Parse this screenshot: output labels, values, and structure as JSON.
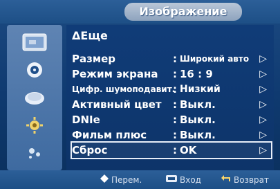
{
  "header": {
    "title": "Изображение"
  },
  "section": {
    "title": "ΔЕще"
  },
  "menu": {
    "items": [
      {
        "label": "Размер",
        "value": "Широкий авто",
        "arrow": "▷"
      },
      {
        "label": "Режим экрана",
        "value": "16 : 9",
        "arrow": "▷"
      },
      {
        "label": "Цифр. шумоподавит.",
        "value": "Низкий",
        "arrow": "▷"
      },
      {
        "label": "Активный цвет",
        "value": "Выкл.",
        "arrow": "▷"
      },
      {
        "label": "DNIe",
        "value": "Выкл.",
        "arrow": "▷"
      },
      {
        "label": "Фильм плюс",
        "value": "Выкл.",
        "arrow": "▷"
      },
      {
        "label": "Сброс",
        "value": "OK",
        "arrow": "▷"
      }
    ],
    "separator": ":"
  },
  "footer": {
    "move": "Перем.",
    "enter": "Вход",
    "back": "Возврат"
  },
  "sidebar": {
    "icons": [
      "picture-icon",
      "sound-icon",
      "channel-icon",
      "setup-icon",
      "input-icon"
    ]
  },
  "colors": {
    "background": "#0d3469",
    "title_tab": "#a8b8cc",
    "sidebar": "#4f78aa",
    "text": "#ffffff"
  }
}
